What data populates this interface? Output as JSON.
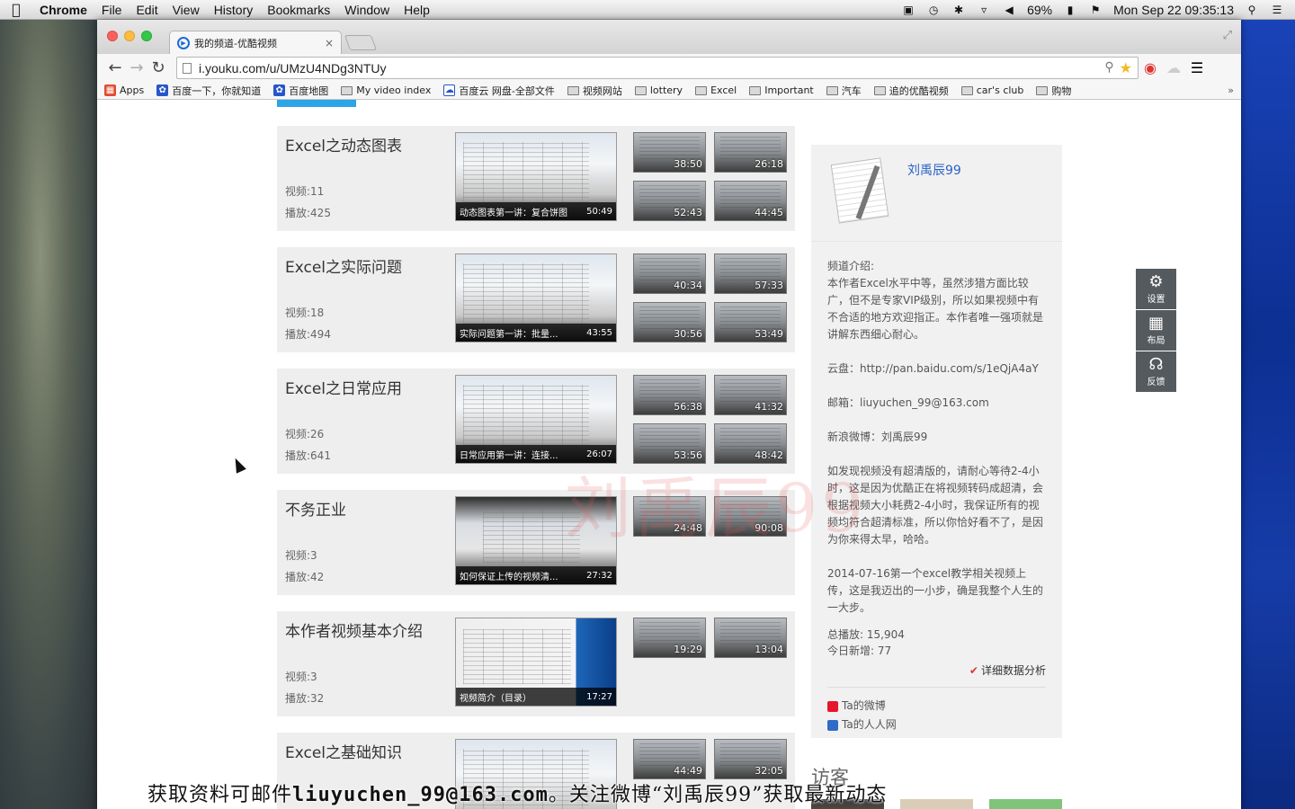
{
  "menubar": {
    "app": "Chrome",
    "items": [
      "File",
      "Edit",
      "View",
      "History",
      "Bookmarks",
      "Window",
      "Help"
    ],
    "battery": "69%",
    "clock": "Mon Sep 22  09:35:13"
  },
  "browser": {
    "tab_title": "我的频道-优酷视频",
    "url": "i.youku.com/u/UMzU4NDg3NTUy",
    "bookmarks": [
      "Apps",
      "百度一下，你就知道",
      "百度地图",
      "My video index",
      "百度云 网盘-全部文件",
      "视频网站",
      "lottery",
      "Excel",
      "Important",
      "汽车",
      "追的优酷视频",
      "car's club",
      "购物"
    ],
    "more": "»"
  },
  "albums": [
    {
      "name": "Excel之动态图表",
      "count": "视频:11",
      "plays": "播放:425",
      "main_caption": "动态图表第一讲：复合饼图",
      "main_duration": "50:49",
      "minis": [
        "38:50",
        "26:18",
        "52:43",
        "44:45"
      ]
    },
    {
      "name": "Excel之实际问题",
      "count": "视频:18",
      "plays": "播放:494",
      "main_caption": "实际问题第一讲：批量...",
      "main_duration": "43:55",
      "minis": [
        "40:34",
        "57:33",
        "30:56",
        "53:49"
      ]
    },
    {
      "name": "Excel之日常应用",
      "count": "视频:26",
      "plays": "播放:641",
      "main_caption": "日常应用第一讲：连接...",
      "main_duration": "26:07",
      "minis": [
        "56:38",
        "41:32",
        "53:56",
        "48:42"
      ]
    },
    {
      "name": "不务正业",
      "count": "视频:3",
      "plays": "播放:42",
      "main_caption": "如何保证上传的视频清...",
      "main_duration": "27:32",
      "minis": [
        "24:48",
        "90:08"
      ]
    },
    {
      "name": "本作者视频基本介绍",
      "count": "视频:3",
      "plays": "播放:32",
      "main_caption": "视频简介（目录）",
      "main_duration": "17:27",
      "minis": [
        "19:29",
        "13:04"
      ]
    },
    {
      "name": "Excel之基础知识",
      "count": "",
      "plays": "",
      "main_caption": "",
      "main_duration": "",
      "minis": [
        "44:49",
        "32:05"
      ]
    }
  ],
  "sidebar": {
    "username": "刘禹辰99",
    "intro_label": "频道介绍:",
    "intro_text": "本作者Excel水平中等，虽然涉猎方面比较广，但不是专家VIP级别，所以如果视频中有不合适的地方欢迎指正。本作者唯一强项就是讲解东西细心耐心。",
    "cloud": "云盘：http://pan.baidu.com/s/1eQjA4aY",
    "email": "邮箱：liuyuchen_99@163.com",
    "weibo": "新浪微博：刘禹辰99",
    "notice": "如发现视频没有超清版的，请耐心等待2-4小时，这是因为优酷正在将视频转码成超清，会根据视频大小耗费2-4小时，我保证所有的视频均符合超清标准，所以你恰好看不了，是因为你来得太早，哈哈。",
    "history": "2014-07-16第一个excel教学相关视频上传，这是我迈出的一小步，确是我整个人生的一大步。",
    "total_plays": "总播放: 15,904",
    "today_new": "今日新增: 77",
    "detail_link": "详细数据分析",
    "sns_weibo": "Ta的微博",
    "sns_renren": "Ta的人人网"
  },
  "visitors_title": "访客",
  "tools": [
    "设置",
    "布局",
    "反馈"
  ],
  "overlay": {
    "watermark": "刘禹辰99",
    "subtitle_a": "获取资料可邮件",
    "subtitle_email": "liuyuchen_99@163.com",
    "subtitle_b": "。关注微博“刘禹辰99”获取最新动态"
  }
}
